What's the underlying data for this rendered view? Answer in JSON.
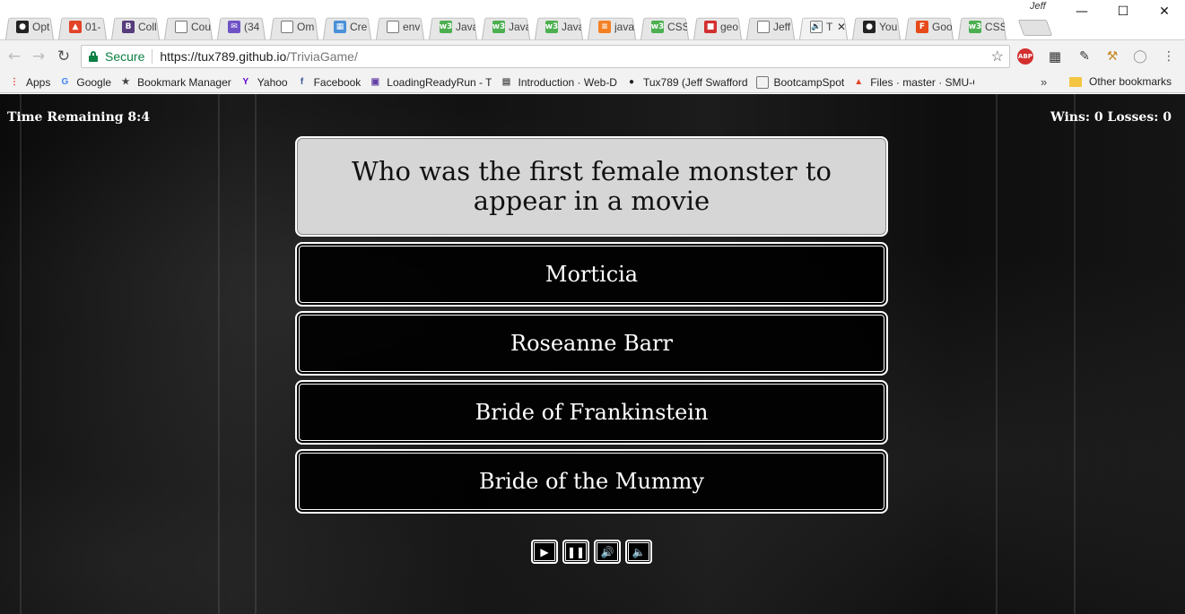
{
  "browser": {
    "profile_name": "Jeff",
    "tabs": [
      {
        "title": "Opt",
        "favicon": "github-icon",
        "color": "#222222",
        "glyph": "●"
      },
      {
        "title": "01-",
        "favicon": "gitlab-icon",
        "color": "#e24329",
        "glyph": "▲"
      },
      {
        "title": "Coll",
        "favicon": "bootstrap-icon",
        "color": "#563d7c",
        "glyph": "B"
      },
      {
        "title": "Cou",
        "favicon": "page-icon",
        "color": "#ffffff",
        "glyph": ""
      },
      {
        "title": "(34",
        "favicon": "mail-icon",
        "color": "#6f52c6",
        "glyph": "✉"
      },
      {
        "title": "Om",
        "favicon": "page-icon",
        "color": "#ffffff",
        "glyph": ""
      },
      {
        "title": "Cre",
        "favicon": "calendar-icon",
        "color": "#4a90d9",
        "glyph": "▦"
      },
      {
        "title": "env",
        "favicon": "page-icon",
        "color": "#ffffff",
        "glyph": ""
      },
      {
        "title": "Java",
        "favicon": "w3schools-icon",
        "color": "#4caf50",
        "glyph": "w3"
      },
      {
        "title": "Java",
        "favicon": "w3schools-icon",
        "color": "#4caf50",
        "glyph": "w3"
      },
      {
        "title": "Java",
        "favicon": "w3schools-icon",
        "color": "#4caf50",
        "glyph": "w3"
      },
      {
        "title": "java",
        "favicon": "stackoverflow-icon",
        "color": "#f48024",
        "glyph": "≡"
      },
      {
        "title": "CSS",
        "favicon": "w3schools-icon",
        "color": "#4caf50",
        "glyph": "w3"
      },
      {
        "title": "geo",
        "favicon": "geo-icon",
        "color": "#d32f2f",
        "glyph": "■"
      },
      {
        "title": "Jeff",
        "favicon": "page-icon",
        "color": "#ffffff",
        "glyph": ""
      },
      {
        "title": "T",
        "favicon": "speaker-icon",
        "color": "#ffffff",
        "glyph": "🔊",
        "active": true
      },
      {
        "title": "You",
        "favicon": "github-icon",
        "color": "#222222",
        "glyph": "●"
      },
      {
        "title": "Goo",
        "favicon": "firebase-icon",
        "color": "#e64a19",
        "glyph": "F"
      },
      {
        "title": "CSS",
        "favicon": "w3schools-icon",
        "color": "#4caf50",
        "glyph": "w3"
      }
    ],
    "url": {
      "secure_label": "Secure",
      "host": "https://tux789.github.io",
      "path": "/TriviaGame/"
    },
    "bookmarks": [
      {
        "label": "Apps",
        "icon": "apps-grid-icon",
        "color": "#e53935",
        "glyph": "⋮"
      },
      {
        "label": "Google",
        "icon": "google-icon",
        "color": "#4285f4",
        "glyph": "G"
      },
      {
        "label": "Bookmark Manager",
        "icon": "star-icon",
        "color": "#444444",
        "glyph": "★"
      },
      {
        "label": "Yahoo",
        "icon": "yahoo-icon",
        "color": "#5f01d1",
        "glyph": "Y"
      },
      {
        "label": "Facebook",
        "icon": "facebook-icon",
        "color": "#3b5998",
        "glyph": "f"
      },
      {
        "label": "LoadingReadyRun - T",
        "icon": "twitch-icon",
        "color": "#6441a5",
        "glyph": "▣"
      },
      {
        "label": "Introduction · Web-D",
        "icon": "book-icon",
        "color": "#555555",
        "glyph": "▤"
      },
      {
        "label": "Tux789 (Jeff Swafford",
        "icon": "github-icon",
        "color": "#222222",
        "glyph": "●"
      },
      {
        "label": "BootcampSpot",
        "icon": "page-icon",
        "color": "#ffffff",
        "glyph": ""
      },
      {
        "label": "Files · master · SMU-C",
        "icon": "gitlab-icon",
        "color": "#e24329",
        "glyph": "▲"
      }
    ],
    "bookmarks_more": "»",
    "other_bookmarks": "Other bookmarks"
  },
  "game": {
    "timer_label": "Time Remaining 8:4",
    "score_label": "Wins: 0 Losses: 0",
    "question": "Who was the first female monster to appear in a movie",
    "answers": [
      "Morticia",
      "Roseanne Barr",
      "Bride of Frankinstein",
      "Bride of the Mummy"
    ],
    "controls": [
      {
        "name": "play-icon",
        "glyph": "▶"
      },
      {
        "name": "pause-icon",
        "glyph": "❚❚"
      },
      {
        "name": "volume-up-icon",
        "glyph": "🔊"
      },
      {
        "name": "volume-down-icon",
        "glyph": "🔈"
      }
    ]
  }
}
